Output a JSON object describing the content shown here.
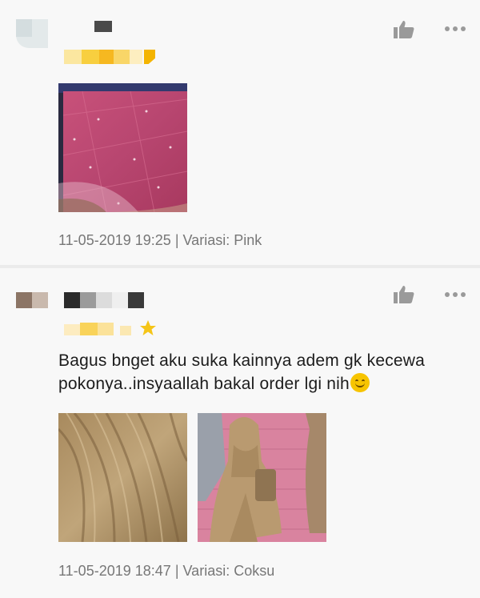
{
  "reviews": [
    {
      "date": "11-05-2019 19:25",
      "variation": "Variasi: Pink",
      "separator": "|",
      "text": "",
      "photos": [
        "pink-fabric-photo"
      ]
    },
    {
      "date": "11-05-2019 18:47",
      "variation": "Variasi: Coksu",
      "separator": "|",
      "text_line1": "Bagus bnget aku suka kainnya adem gk kecewa",
      "text_line2": "pokonya..insyaallah bakal order lgi nih",
      "photos": [
        "brown-fabric-photo",
        "hijab-model-photo"
      ]
    }
  ],
  "colors": {
    "star": "#f5c518",
    "meta_text": "#777777",
    "icon_gray": "#9a9a9a"
  },
  "icons": [
    "thumbs-up-icon",
    "more-options-icon",
    "smile-emoji-icon"
  ]
}
